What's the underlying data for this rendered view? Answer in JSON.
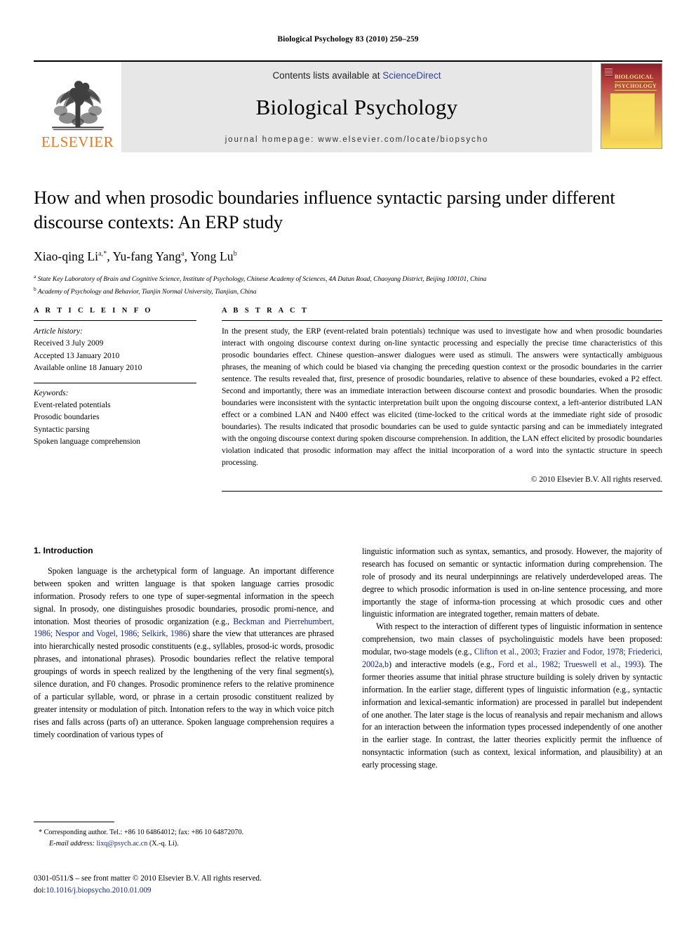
{
  "running_head": "Biological Psychology 83 (2010) 250–259",
  "masthead": {
    "publisher_name": "ELSEVIER",
    "contents_prefix": "Contents lists available at ",
    "contents_link": "ScienceDirect",
    "journal_title": "Biological Psychology",
    "homepage": "journal homepage: www.elsevier.com/locate/biopsycho",
    "cover_title_line1": "BIOLOGICAL",
    "cover_title_line2": "PSYCHOLOGY"
  },
  "article": {
    "title": "How and when prosodic boundaries influence syntactic parsing under different discourse contexts: An ERP study",
    "authors_html": "Xiao-qing Li a,*, Yu-fang Yang a, Yong Lu b",
    "affiliation_a": "State Key Laboratory of Brain and Cognitive Science, Institute of Psychology, Chinese Academy of Sciences, 4A Datun Road, Chaoyang District, Beijing 100101, China",
    "affiliation_b": "Academy of Psychology and Behavior, Tianjin Normal University, Tianjian, China"
  },
  "article_info": {
    "heading": "A R T I C L E  I N F O",
    "history_label": "Article history:",
    "history": [
      "Received 3 July 2009",
      "Accepted 13 January 2010",
      "Available online 18 January 2010"
    ],
    "keywords_label": "Keywords:",
    "keywords": [
      "Event-related potentials",
      "Prosodic boundaries",
      "Syntactic parsing",
      "Spoken language comprehension"
    ]
  },
  "abstract": {
    "heading": "A B S T R A C T",
    "text": "In the present study, the ERP (event-related brain potentials) technique was used to investigate how and when prosodic boundaries interact with ongoing discourse context during on-line syntactic processing and especially the precise time characteristics of this prosodic boundaries effect. Chinese question–answer dialogues were used as stimuli. The answers were syntactically ambiguous phrases, the meaning of which could be biased via changing the preceding question context or the prosodic boundaries in the carrier sentence. The results revealed that, first, presence of prosodic boundaries, relative to absence of these boundaries, evoked a P2 effect. Second and importantly, there was an immediate interaction between discourse context and prosodic boundaries. When the prosodic boundaries were inconsistent with the syntactic interpretation built upon the ongoing discourse context, a left-anterior distributed LAN effect or a combined LAN and N400 effect was elicited (time-locked to the critical words at the immediate right side of prosodic boundaries). The results indicated that prosodic boundaries can be used to guide syntactic parsing and can be immediately integrated with the ongoing discourse context during spoken discourse comprehension. In addition, the LAN effect elicited by prosodic boundaries violation indicated that prosodic information may affect the initial incorporation of a word into the syntactic structure in speech processing.",
    "copyright": "© 2010 Elsevier B.V. All rights reserved."
  },
  "body": {
    "section_heading": "1. Introduction",
    "left_para_1_a": "Spoken language is the archetypical form of language. An important difference between spoken and written language is that spoken language carries prosodic information. Prosody refers to one type of super-segmental information in the speech signal. In prosody, one distinguishes prosodic boundaries, prosodic promi-nence, and intonation. Most theories of prosodic organization (e.g., ",
    "left_cite_1": "Beckman and Pierrehumbert, 1986; Nespor and Vogel, 1986; Selkirk, 1986",
    "left_para_1_b": ") share the view that utterances are phrased into hierarchically nested prosodic constituents (e.g., syllables, prosod-ic words, prosodic phrases, and intonational phrases). Prosodic boundaries reflect the relative temporal groupings of words in speech realized by the lengthening of the very final segment(s), silence duration, and F0 changes. Prosodic prominence refers to the relative prominence of a particular syllable, word, or phrase in a certain prosodic constituent realized by greater intensity or modulation of pitch. Intonation refers to the way in which voice pitch rises and falls across (parts of) an utterance. Spoken language comprehension requires a timely coordination of various types of",
    "right_para_1_cont": "linguistic information such as syntax, semantics, and prosody. However, the majority of research has focused on semantic or syntactic information during comprehension. The role of prosody and its neural underpinnings are relatively underdeveloped areas. The degree to which prosodic information is used in on-line sentence processing, and more importantly the stage of informa-tion processing at which prosodic cues and other linguistic information are integrated together, remain matters of debate.",
    "right_para_2_a": "With respect to the interaction of different types of linguistic information in sentence comprehension, two main classes of psycholinguistic models have been proposed: modular, two-stage models (e.g., ",
    "right_cite_1": "Clifton et al., 2003; Frazier and Fodor, 1978; Friederici, 2002a,b",
    "right_para_2_b": ") and interactive models (e.g., ",
    "right_cite_2": "Ford et al., 1982; Trueswell et al., 1993",
    "right_para_2_c": "). The former theories assume that initial phrase structure building is solely driven by syntactic information. In the earlier stage, different types of linguistic information (e.g., syntactic information and lexical-semantic information) are processed in parallel but independent of one another. The later stage is the locus of reanalysis and repair mechanism and allows for an interaction between the information types processed independently of one another in the earlier stage. In contrast, the latter theories explicitly permit the influence of nonsyntactic information (such as context, lexical information, and plausibility) at an early processing stage."
  },
  "footnote": {
    "marker": "*",
    "line1": "Corresponding author. Tel.: +86 10 64864012; fax: +86 10 64872070.",
    "email_label": "E-mail address:",
    "email": "lixq@psych.ac.cn",
    "email_suffix": "(X.-q. Li)."
  },
  "page_footer": {
    "line1": "0301-0511/$ – see front matter © 2010 Elsevier B.V. All rights reserved.",
    "doi_label": "doi:",
    "doi": "10.1016/j.biopsycho.2010.01.009"
  },
  "colors": {
    "link_blue": "#14267a",
    "sciencedirect_blue": "#2b41a6",
    "elsevier_orange": "#E87722",
    "banner_gray": "#e7e7e7"
  }
}
